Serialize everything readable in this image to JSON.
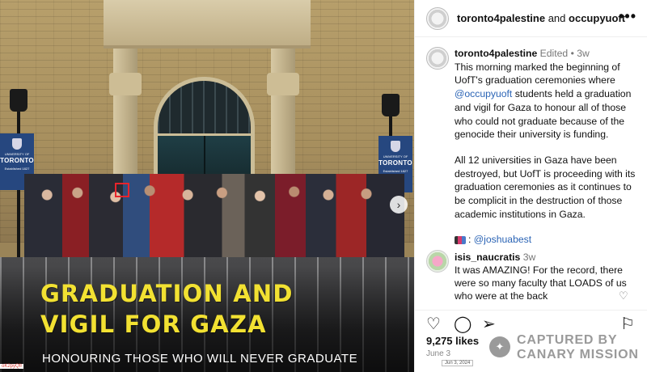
{
  "image": {
    "headline_line1": "GRADUATION AND",
    "headline_line2": "VIGIL FOR GAZA",
    "subline": "HONOURING THOSE WHO WILL NEVER GRADUATE",
    "banner_left": {
      "university_of": "UNIVERSITY OF",
      "name": "TORONTO",
      "tagline": "Established 1827"
    },
    "banner_right": {
      "university_of": "UNIVERSITY OF",
      "name": "TORONTO",
      "tagline": "Established 1827"
    },
    "next_glyph": "›",
    "corner_tag": "oK2pyQfr"
  },
  "header": {
    "account": "toronto4palestine",
    "connector": "and",
    "collaborator": "occupyuoft",
    "more_glyph": "•••"
  },
  "post": {
    "username": "toronto4palestine",
    "edited": "Edited •",
    "age": "3w",
    "p1_a": "This morning marked the beginning of UofT's graduation ceremonies where ",
    "p1_mention": "@occupyuoft",
    "p1_b": " students held a graduation and vigil for Gaza to honour all of those who could not graduate because of the genocide their university is funding.",
    "p2": "All 12 universities in Gaza have been destroyed, but UofT is proceeding with its graduation ceremonies as it continues to be complicit in the destruction of those academic institutions in Gaza.",
    "credit_label": ": ",
    "credit_mention": "@joshuabest"
  },
  "comment": {
    "username": "isis_naucratis",
    "age": "3w",
    "text": "It was AMAZING! For the record, there were so many faculty that LOADS of us who were at the back"
  },
  "actions": {
    "like_icon": "heart-icon",
    "comment_icon": "comment-icon",
    "share_icon": "send-icon",
    "save_icon": "bookmark-icon"
  },
  "likes": "9,275 likes",
  "date": "June 3",
  "datestamp": "Jun 3, 2024",
  "watermark": {
    "line1": "CAPTURED BY",
    "line2": "CANARY MISSION"
  },
  "colors": {
    "headline": "#f2e132",
    "mention": "#2b64b5",
    "watermark": "#9a9a9a",
    "red_box": "#e8242b"
  }
}
